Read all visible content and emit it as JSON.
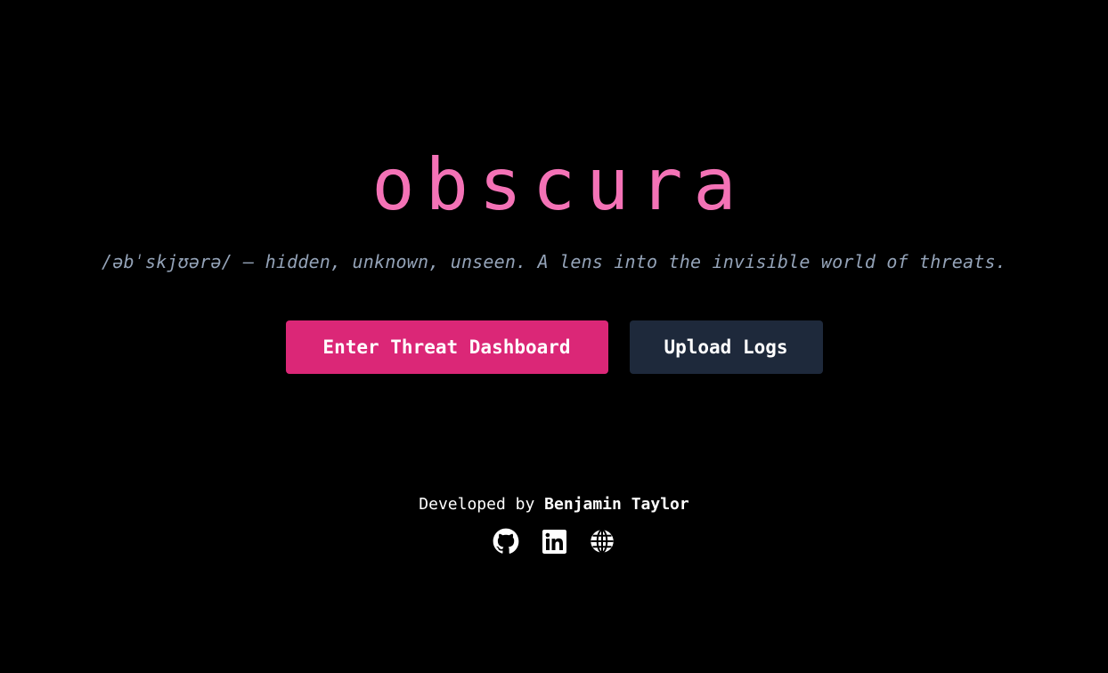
{
  "theme": {
    "background": "#000000",
    "title_color": "#f472b6",
    "subtitle_color": "#94a3b8",
    "primary_button_bg": "#db2777",
    "secondary_button_bg": "#1e293b",
    "text_color": "#ffffff"
  },
  "hero": {
    "title": "obscura",
    "subtitle": "/əbˈskjʊərə/ — hidden, unknown, unseen. A lens into the invisible world of threats."
  },
  "actions": {
    "primary_label": "Enter Threat Dashboard",
    "secondary_label": "Upload Logs"
  },
  "footer": {
    "developed_by_prefix": "Developed by",
    "developer_name": "Benjamin Taylor",
    "socials": [
      {
        "icon": "github-icon"
      },
      {
        "icon": "linkedin-icon"
      },
      {
        "icon": "globe-icon"
      }
    ]
  }
}
